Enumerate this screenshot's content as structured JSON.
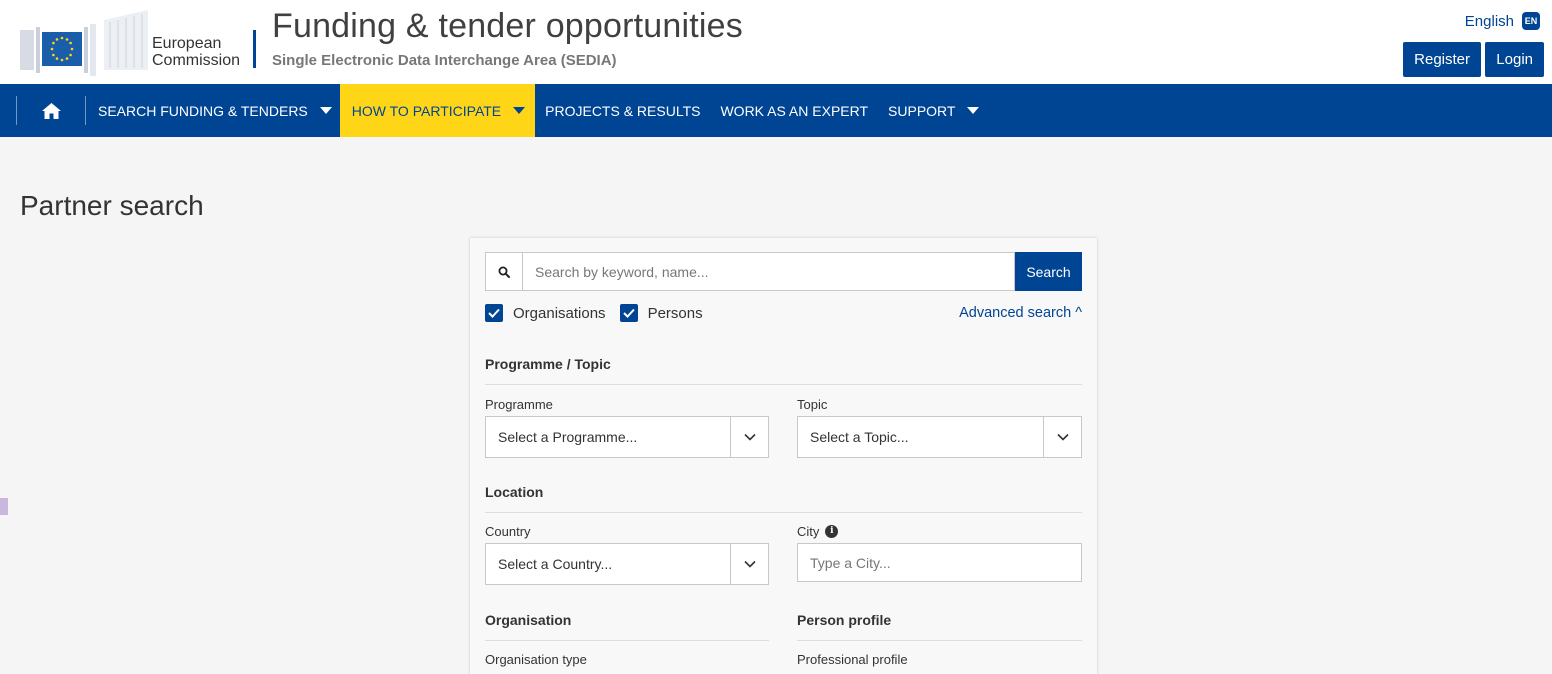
{
  "header": {
    "brand_line1": "European",
    "brand_line2": "Commission",
    "title": "Funding & tender opportunities",
    "subtitle": "Single Electronic Data Interchange Area (SEDIA)",
    "language": "English",
    "language_code": "EN",
    "register_label": "Register",
    "login_label": "Login"
  },
  "nav": {
    "items": [
      {
        "label": "SEARCH FUNDING & TENDERS",
        "has_dropdown": true
      },
      {
        "label": "HOW TO PARTICIPATE",
        "has_dropdown": true,
        "active": true
      },
      {
        "label": "PROJECTS & RESULTS",
        "has_dropdown": false
      },
      {
        "label": "WORK AS AN EXPERT",
        "has_dropdown": false
      },
      {
        "label": "SUPPORT",
        "has_dropdown": true
      }
    ]
  },
  "page": {
    "title": "Partner search"
  },
  "search": {
    "placeholder": "Search by keyword, name...",
    "button_label": "Search",
    "check_organisations": "Organisations",
    "check_persons": "Persons",
    "advanced_link": "Advanced search ^"
  },
  "filters": {
    "programme_topic_heading": "Programme / Topic",
    "programme_label": "Programme",
    "programme_value": "Select a Programme...",
    "topic_label": "Topic",
    "topic_value": "Select a Topic...",
    "location_heading": "Location",
    "country_label": "Country",
    "country_value": "Select a Country...",
    "city_label": "City",
    "city_placeholder": "Type a City...",
    "organisation_heading": "Organisation",
    "organisation_type_label": "Organisation type",
    "person_profile_heading": "Person profile",
    "professional_profile_label": "Professional profile"
  },
  "colors": {
    "primary": "#004494",
    "accent": "#ffd617"
  }
}
